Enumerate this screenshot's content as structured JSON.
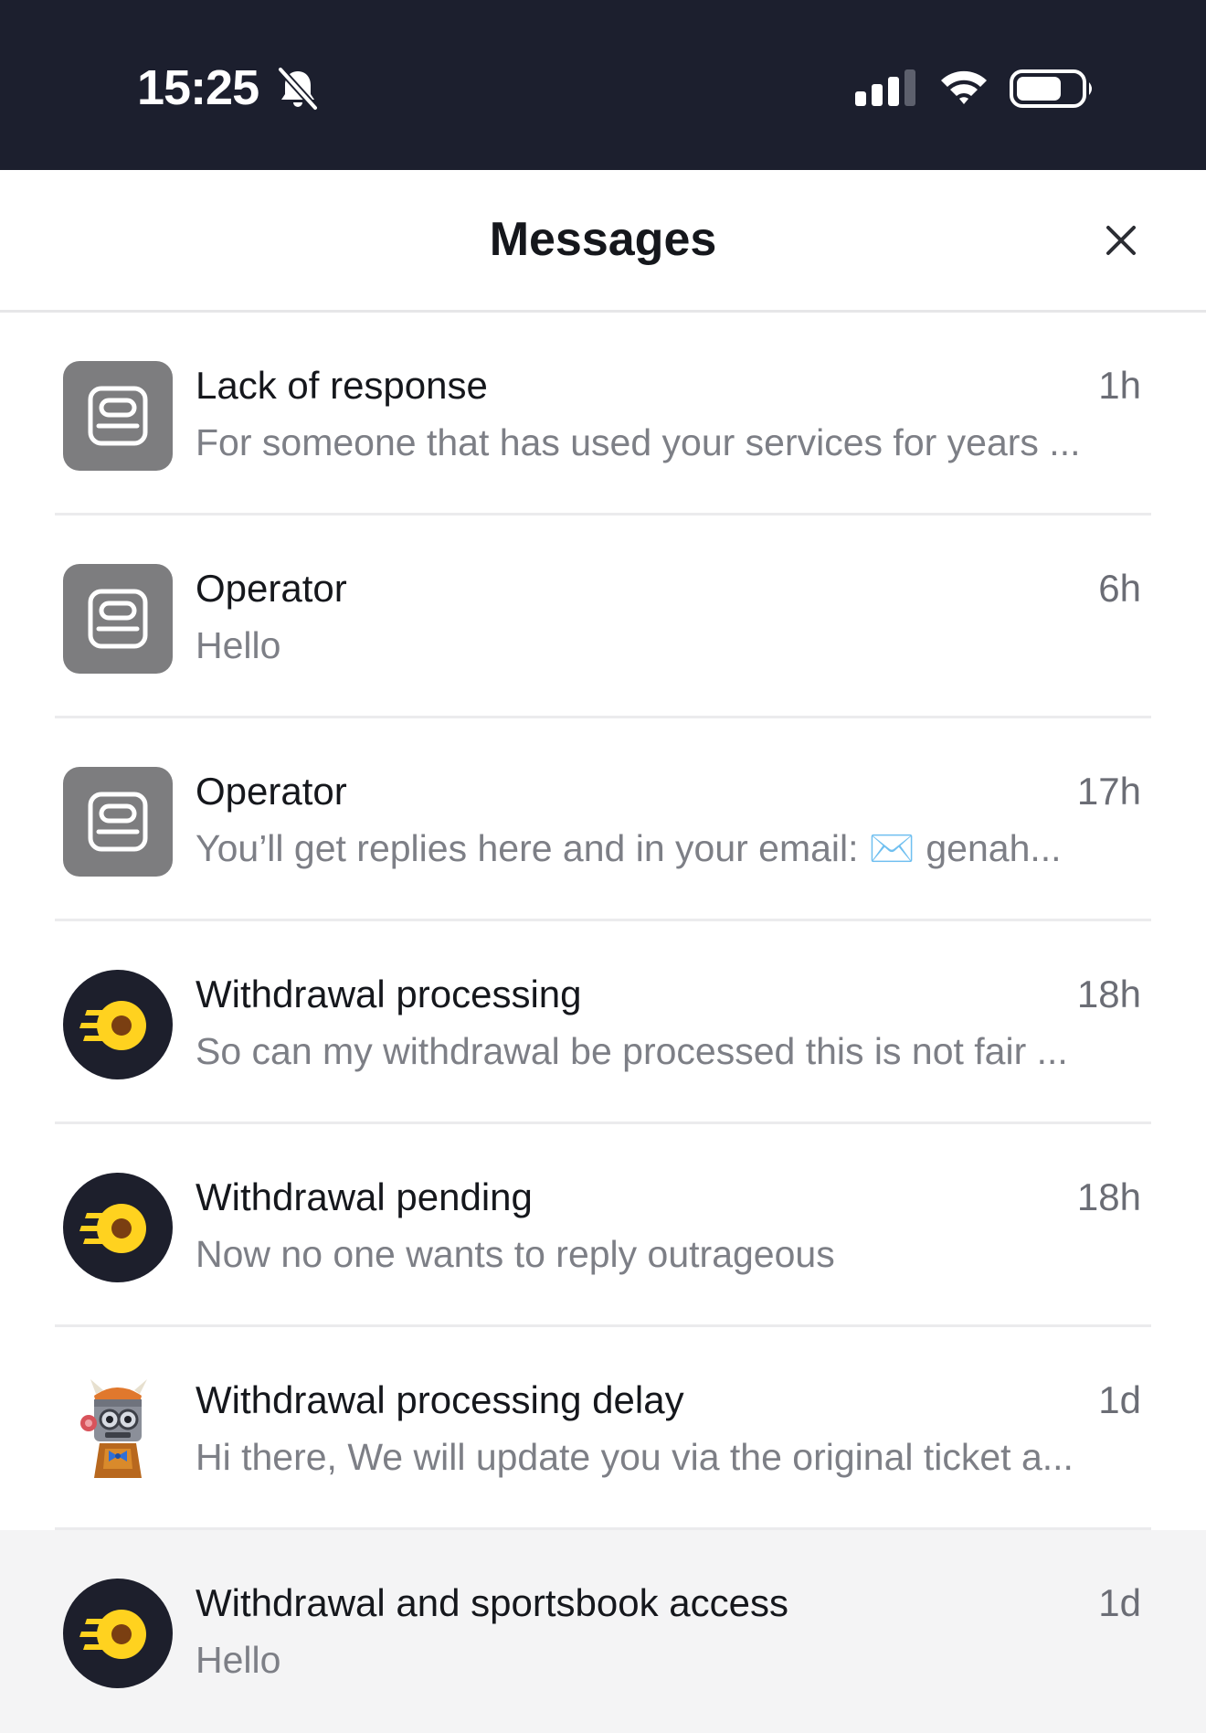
{
  "status_bar": {
    "time": "15:25",
    "icons": [
      "bell-slash-icon",
      "cellular-signal-icon",
      "wifi-icon",
      "battery-icon"
    ]
  },
  "header": {
    "title": "Messages",
    "close_icon": "close-icon"
  },
  "colors": {
    "status_bar_bg": "#1c1f2e",
    "avatar_square_bg": "#7d7d7f",
    "avatar_circle_bg": "#1d1f2c",
    "logo_yellow": "#ffd21f",
    "highlight_row_bg": "#f4f4f5"
  },
  "messages": [
    {
      "title": "Lack of response",
      "time": "1h",
      "preview": "For someone that has used your services for years ...",
      "avatar": "ticket-icon"
    },
    {
      "title": "Operator",
      "time": "6h",
      "preview": "Hello",
      "avatar": "ticket-icon"
    },
    {
      "title": "Operator",
      "time": "17h",
      "preview": "You’ll get replies here and in your email: ✉️ genah...",
      "avatar": "ticket-icon"
    },
    {
      "title": "Withdrawal processing",
      "time": "18h",
      "preview": "So can my withdrawal be processed this is not fair ...",
      "avatar": "brand-logo-icon"
    },
    {
      "title": "Withdrawal pending",
      "time": "18h",
      "preview": "Now no one wants to reply outrageous",
      "avatar": "brand-logo-icon"
    },
    {
      "title": "Withdrawal processing delay",
      "time": "1d",
      "preview": "Hi there, We will update you via the original ticket a...",
      "avatar": "robot-mascot-icon"
    },
    {
      "title": "Withdrawal and sportsbook access",
      "time": "1d",
      "preview": "Hello",
      "avatar": "brand-logo-icon"
    }
  ]
}
